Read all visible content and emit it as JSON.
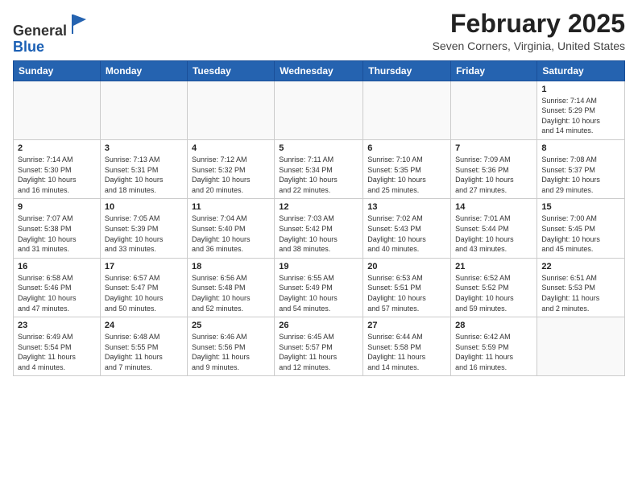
{
  "header": {
    "logo_general": "General",
    "logo_blue": "Blue",
    "month_title": "February 2025",
    "location": "Seven Corners, Virginia, United States"
  },
  "days_of_week": [
    "Sunday",
    "Monday",
    "Tuesday",
    "Wednesday",
    "Thursday",
    "Friday",
    "Saturday"
  ],
  "weeks": [
    [
      {
        "day": "",
        "info": ""
      },
      {
        "day": "",
        "info": ""
      },
      {
        "day": "",
        "info": ""
      },
      {
        "day": "",
        "info": ""
      },
      {
        "day": "",
        "info": ""
      },
      {
        "day": "",
        "info": ""
      },
      {
        "day": "1",
        "info": "Sunrise: 7:14 AM\nSunset: 5:29 PM\nDaylight: 10 hours\nand 14 minutes."
      }
    ],
    [
      {
        "day": "2",
        "info": "Sunrise: 7:14 AM\nSunset: 5:30 PM\nDaylight: 10 hours\nand 16 minutes."
      },
      {
        "day": "3",
        "info": "Sunrise: 7:13 AM\nSunset: 5:31 PM\nDaylight: 10 hours\nand 18 minutes."
      },
      {
        "day": "4",
        "info": "Sunrise: 7:12 AM\nSunset: 5:32 PM\nDaylight: 10 hours\nand 20 minutes."
      },
      {
        "day": "5",
        "info": "Sunrise: 7:11 AM\nSunset: 5:34 PM\nDaylight: 10 hours\nand 22 minutes."
      },
      {
        "day": "6",
        "info": "Sunrise: 7:10 AM\nSunset: 5:35 PM\nDaylight: 10 hours\nand 25 minutes."
      },
      {
        "day": "7",
        "info": "Sunrise: 7:09 AM\nSunset: 5:36 PM\nDaylight: 10 hours\nand 27 minutes."
      },
      {
        "day": "8",
        "info": "Sunrise: 7:08 AM\nSunset: 5:37 PM\nDaylight: 10 hours\nand 29 minutes."
      }
    ],
    [
      {
        "day": "9",
        "info": "Sunrise: 7:07 AM\nSunset: 5:38 PM\nDaylight: 10 hours\nand 31 minutes."
      },
      {
        "day": "10",
        "info": "Sunrise: 7:05 AM\nSunset: 5:39 PM\nDaylight: 10 hours\nand 33 minutes."
      },
      {
        "day": "11",
        "info": "Sunrise: 7:04 AM\nSunset: 5:40 PM\nDaylight: 10 hours\nand 36 minutes."
      },
      {
        "day": "12",
        "info": "Sunrise: 7:03 AM\nSunset: 5:42 PM\nDaylight: 10 hours\nand 38 minutes."
      },
      {
        "day": "13",
        "info": "Sunrise: 7:02 AM\nSunset: 5:43 PM\nDaylight: 10 hours\nand 40 minutes."
      },
      {
        "day": "14",
        "info": "Sunrise: 7:01 AM\nSunset: 5:44 PM\nDaylight: 10 hours\nand 43 minutes."
      },
      {
        "day": "15",
        "info": "Sunrise: 7:00 AM\nSunset: 5:45 PM\nDaylight: 10 hours\nand 45 minutes."
      }
    ],
    [
      {
        "day": "16",
        "info": "Sunrise: 6:58 AM\nSunset: 5:46 PM\nDaylight: 10 hours\nand 47 minutes."
      },
      {
        "day": "17",
        "info": "Sunrise: 6:57 AM\nSunset: 5:47 PM\nDaylight: 10 hours\nand 50 minutes."
      },
      {
        "day": "18",
        "info": "Sunrise: 6:56 AM\nSunset: 5:48 PM\nDaylight: 10 hours\nand 52 minutes."
      },
      {
        "day": "19",
        "info": "Sunrise: 6:55 AM\nSunset: 5:49 PM\nDaylight: 10 hours\nand 54 minutes."
      },
      {
        "day": "20",
        "info": "Sunrise: 6:53 AM\nSunset: 5:51 PM\nDaylight: 10 hours\nand 57 minutes."
      },
      {
        "day": "21",
        "info": "Sunrise: 6:52 AM\nSunset: 5:52 PM\nDaylight: 10 hours\nand 59 minutes."
      },
      {
        "day": "22",
        "info": "Sunrise: 6:51 AM\nSunset: 5:53 PM\nDaylight: 11 hours\nand 2 minutes."
      }
    ],
    [
      {
        "day": "23",
        "info": "Sunrise: 6:49 AM\nSunset: 5:54 PM\nDaylight: 11 hours\nand 4 minutes."
      },
      {
        "day": "24",
        "info": "Sunrise: 6:48 AM\nSunset: 5:55 PM\nDaylight: 11 hours\nand 7 minutes."
      },
      {
        "day": "25",
        "info": "Sunrise: 6:46 AM\nSunset: 5:56 PM\nDaylight: 11 hours\nand 9 minutes."
      },
      {
        "day": "26",
        "info": "Sunrise: 6:45 AM\nSunset: 5:57 PM\nDaylight: 11 hours\nand 12 minutes."
      },
      {
        "day": "27",
        "info": "Sunrise: 6:44 AM\nSunset: 5:58 PM\nDaylight: 11 hours\nand 14 minutes."
      },
      {
        "day": "28",
        "info": "Sunrise: 6:42 AM\nSunset: 5:59 PM\nDaylight: 11 hours\nand 16 minutes."
      },
      {
        "day": "",
        "info": ""
      }
    ]
  ]
}
